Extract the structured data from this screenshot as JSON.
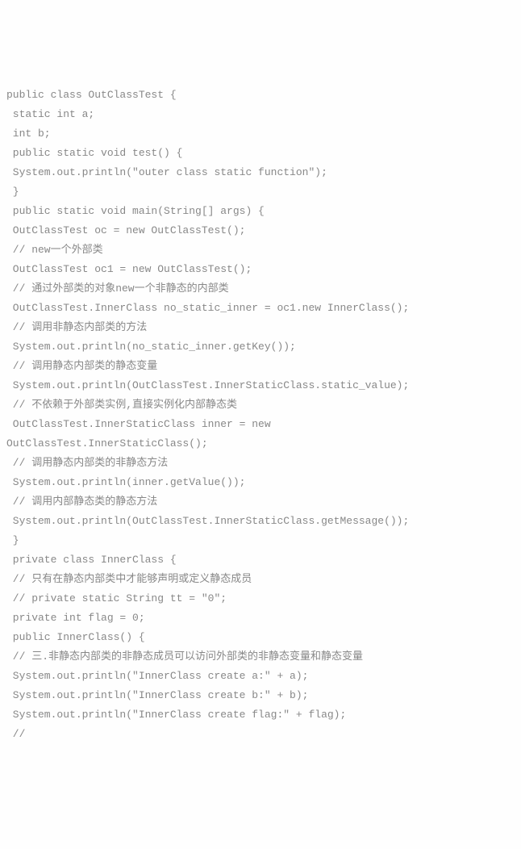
{
  "code": {
    "lines": [
      "public class OutClassTest {",
      " static int a;",
      " int b;",
      " public static void test() {",
      " System.out.println(\"outer class static function\");",
      " }",
      " public static void main(String[] args) {",
      " OutClassTest oc = new OutClassTest();",
      " // new一个外部类",
      " OutClassTest oc1 = new OutClassTest();",
      " // 通过外部类的对象new一个非静态的内部类",
      " OutClassTest.InnerClass no_static_inner = oc1.new InnerClass();",
      " // 调用非静态内部类的方法",
      " System.out.println(no_static_inner.getKey());",
      " // 调用静态内部类的静态变量",
      " System.out.println(OutClassTest.InnerStaticClass.static_value);",
      " // 不依赖于外部类实例,直接实例化内部静态类",
      " OutClassTest.InnerStaticClass inner = new",
      "OutClassTest.InnerStaticClass();",
      " // 调用静态内部类的非静态方法",
      " System.out.println(inner.getValue());",
      " // 调用内部静态类的静态方法",
      " System.out.println(OutClassTest.InnerStaticClass.getMessage());",
      " }",
      " private class InnerClass {",
      " // 只有在静态内部类中才能够声明或定义静态成员",
      " // private static String tt = \"0\";",
      " private int flag = 0;",
      " public InnerClass() {",
      " // 三.非静态内部类的非静态成员可以访问外部类的非静态变量和静态变量",
      " System.out.println(\"InnerClass create a:\" + a);",
      " System.out.println(\"InnerClass create b:\" + b);",
      " System.out.println(\"InnerClass create flag:\" + flag);",
      " //"
    ]
  }
}
